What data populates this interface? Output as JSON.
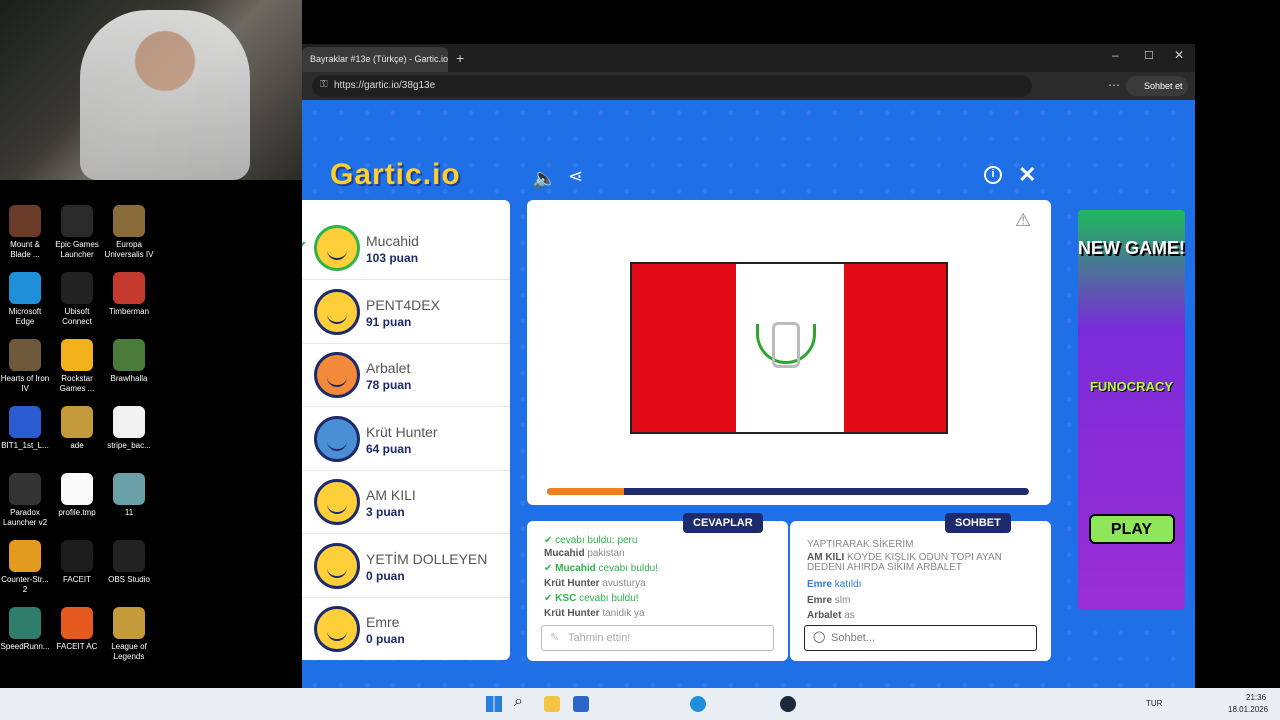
{
  "desktop": {
    "icons": [
      {
        "label": "Mount & Blade ...",
        "color": "#6b3b2a"
      },
      {
        "label": "Epic Games Launcher",
        "color": "#2a2a2a"
      },
      {
        "label": "Europa Universalis IV",
        "color": "#8a6b3a"
      },
      {
        "label": "Microsoft Edge",
        "color": "#1e8fd8"
      },
      {
        "label": "Ubisoft Connect",
        "color": "#222"
      },
      {
        "label": "Timberman",
        "color": "#c53a2e"
      },
      {
        "label": "Hearts of Iron IV",
        "color": "#6e5a3a"
      },
      {
        "label": "Rockstar Games ...",
        "color": "#f3b21c"
      },
      {
        "label": "Brawlhalla",
        "color": "#4a7b3b"
      },
      {
        "label": "BIT1_1st_L...",
        "color": "#2a5bd0"
      },
      {
        "label": "ade",
        "color": "#c49a3a"
      },
      {
        "label": "stripe_bac...",
        "color": "#f2f2f2"
      },
      {
        "label": "Paradox Launcher v2",
        "color": "#333"
      },
      {
        "label": "profile.tmp",
        "color": "#fafafa"
      },
      {
        "label": "11",
        "color": "#6aa1a8"
      },
      {
        "label": "Counter-Str... 2",
        "color": "#e29a1f"
      },
      {
        "label": "FACEIT",
        "color": "#1c1c1c"
      },
      {
        "label": "OBS Studio",
        "color": "#222"
      },
      {
        "label": "SpeedRunn...",
        "color": "#2e7d6b"
      },
      {
        "label": "FACEIT AC",
        "color": "#e65a1f"
      },
      {
        "label": "League of Legends",
        "color": "#c49a3a"
      }
    ]
  },
  "browser": {
    "tab_title": "Bayraklar #13e (Türkçe) - Gartic.io",
    "url": "https://gartic.io/38g13e",
    "chat_button": "Sohbet et"
  },
  "game": {
    "logo": "Gartic.io",
    "players": [
      {
        "name": "Mucahid",
        "score": "103 puan",
        "color": "#ffcf3a",
        "guessed": true
      },
      {
        "name": "PENT4DEX",
        "score": "91 puan",
        "color": "#ffcf3a"
      },
      {
        "name": "Arbalet",
        "score": "78 puan",
        "color": "#f28a3a"
      },
      {
        "name": "Krüt Hunter",
        "score": "64 puan",
        "color": "#4a8fd6"
      },
      {
        "name": "AM KILI",
        "score": "3 puan",
        "color": "#ffcf3a"
      },
      {
        "name": "YETİM DOLLEYEN",
        "score": "0 puan",
        "color": "#ffcf3a"
      },
      {
        "name": "Emre",
        "score": "0 puan",
        "color": "#ffcf3a"
      }
    ],
    "progress": 0.16,
    "answers_header": "CEVAPLAR",
    "chat_header": "SOHBET",
    "answers": [
      {
        "name": "",
        "text": "cevabı buldu: peru",
        "type": "success"
      },
      {
        "name": "Mucahid",
        "text": "pakistan",
        "type": "msg"
      },
      {
        "name": "Mucahid",
        "text": "cevabı buldu!",
        "type": "success"
      },
      {
        "name": "Krüt Hunter",
        "text": "avusturya",
        "type": "msg"
      },
      {
        "name": "KSC",
        "text": "cevabı buldu!",
        "type": "success"
      },
      {
        "name": "Krüt Hunter",
        "text": "tanidik ya",
        "type": "msg"
      }
    ],
    "chat": [
      {
        "name": "",
        "text": "YAPTIRARAK SİKERİM",
        "type": "msg"
      },
      {
        "name": "AM KILI",
        "text": "KOYDE KIŞLIK ODUN TOPI AYAN DEDENI AHIRDA SIKIM ARBALET",
        "type": "msg"
      },
      {
        "name": "Emre",
        "text": "katıldı",
        "type": "info"
      },
      {
        "name": "Emre",
        "text": "slm",
        "type": "msg"
      },
      {
        "name": "Arbalet",
        "text": "as",
        "type": "msg"
      }
    ],
    "answer_placeholder": "Tahmin ettin!",
    "chat_placeholder": "Sohbet...",
    "ad": {
      "title": "NEW GAME!",
      "brand": "FUNOCRACY",
      "play": "PLAY"
    }
  },
  "taskbar": {
    "lang": "TUR",
    "time": "21:36",
    "date": "18.01.2026"
  }
}
